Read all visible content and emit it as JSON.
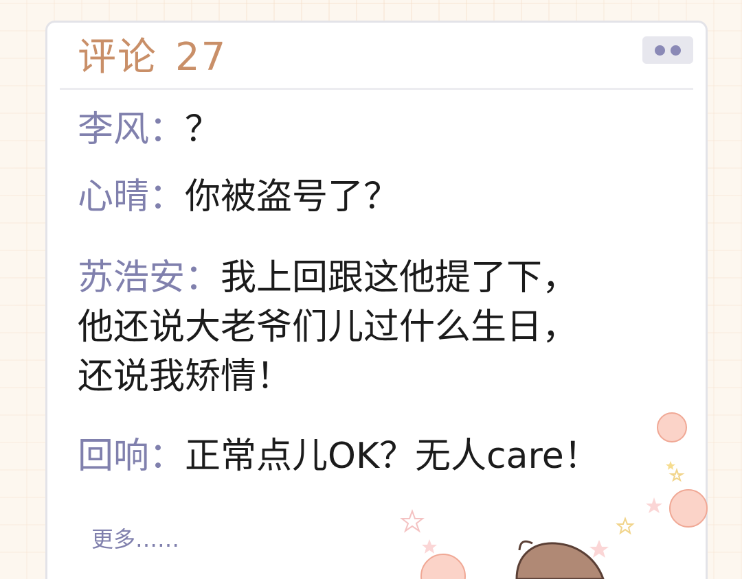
{
  "header": {
    "title": "评论",
    "count": "27",
    "menu_icon": "more-dots-icon"
  },
  "comments": [
    {
      "name": "李风：",
      "text": "？"
    },
    {
      "name": "心晴：",
      "text": "你被盗号了？"
    },
    {
      "name": "苏浩安：",
      "text_lines": [
        "我上回跟这他提了下，",
        "他还说大老爷们儿过什么生日，",
        "还说我矫情！"
      ]
    },
    {
      "name": "回响：",
      "text": "正常点儿OK？无人care！"
    }
  ],
  "more": {
    "label": "更多……"
  },
  "colors": {
    "title": "#c98f68",
    "name": "#8080ad",
    "text": "#1b1b1b",
    "card_border": "#e3e3e8",
    "background": "#fdf7ef"
  }
}
